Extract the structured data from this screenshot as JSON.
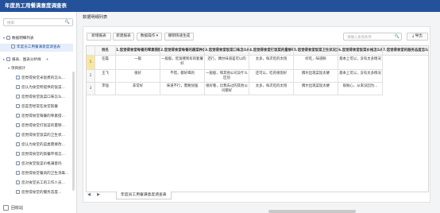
{
  "window": {
    "title": "年度员工用餐满意度调查表"
  },
  "sidebar": {
    "search_placeholder": "搜索",
    "items": [
      {
        "label": "数据明细列表",
        "level": 0,
        "arrow": "▾",
        "icon": "folder-icon"
      },
      {
        "label": "年度员工用餐满意度调查表",
        "level": 1,
        "arrow": "",
        "icon": "table-icon",
        "selected": true
      },
      {
        "label": "报表、图表分析样",
        "level": 0,
        "arrow": "▸",
        "icon": "folder-icon",
        "extra": "+"
      },
      {
        "label": "项目统计",
        "level": 1,
        "arrow": "▾",
        "icon": ""
      },
      {
        "label": "您觉得食堂米饭煮的怎么...",
        "level": 2,
        "icon": "chart-icon"
      },
      {
        "label": "您认为食堂所提供的饭菜...",
        "level": 2,
        "icon": "chart-icon"
      },
      {
        "label": "您觉得食堂饭菜口味怎么...",
        "level": 2,
        "icon": "chart-icon"
      },
      {
        "label": "您是否经常在食堂就餐",
        "level": 2,
        "icon": "chart-icon"
      },
      {
        "label": "您觉得食堂每餐的荤素搭...",
        "level": 2,
        "icon": "chart-icon"
      },
      {
        "label": "您觉得食堂打饭菜的量够...",
        "level": 2,
        "icon": "chart-icon"
      },
      {
        "label": "您觉得食堂饭菜的卫生状...",
        "level": 2,
        "icon": "chart-icon"
      },
      {
        "label": "您认为食堂的菜类需要改...",
        "level": 2,
        "icon": "chart-icon"
      },
      {
        "label": "您觉得食堂的就餐环境怎...",
        "level": 2,
        "icon": "chart-icon"
      },
      {
        "label": "您对食堂饭菜价格满意吗",
        "level": 2,
        "icon": "chart-icon"
      },
      {
        "label": "您觉得食堂餐具的卫生消毒...",
        "level": 2,
        "icon": "chart-icon"
      },
      {
        "label": "您对食堂员工的工作人员...",
        "level": 2,
        "icon": "chart-icon"
      },
      {
        "label": "您觉得食堂的服务态度...",
        "level": 2,
        "icon": "chart-icon"
      }
    ],
    "recycle_label": "回收站"
  },
  "main": {
    "header": "数据明细列表",
    "toolbar": {
      "buttons": [
        "新增报表",
        "新建报表",
        "数据操作 ▾",
        "撤销快速生成"
      ],
      "search_placeholder": "请输入查询条件",
      "export_label": "导出"
    },
    "table": {
      "columns": [
        "",
        "姓名",
        "1.您觉得食堂每餐的荤素搭配怎么样",
        "2.您觉得食堂每餐的蔬菜种类够丰富吗",
        "3.您觉得食堂饭菜口味怎么样",
        "4.您觉得食堂打饭菜的量够吗",
        "5.您觉得食堂饭菜卫生状况怎么样",
        "6.您觉得食堂饭菜价格怎么样",
        "7.您觉得食堂的服务态度怎么样"
      ],
      "rows": [
        {
          "num": "1",
          "cells": [
            "任磊",
            "一般",
            "一般般，吃饭哪到有的套餐好",
            "还行，偶尔味道差可以的",
            "太多，每次吃的太饱",
            "好吃，味道鲜",
            "基本上可以，没有太多情况"
          ]
        },
        {
          "num": "2",
          "cells": [
            "王飞",
            "很好",
            "不错，都好喝的",
            "一般般，和其他公司没什么区别",
            "还可以，吃的很饱好",
            "偶尔出现菜饭太硬",
            "基本上可以，没有太多情况"
          ]
        },
        {
          "num": "3",
          "cells": [
            "李强",
            "非常好",
            "味道不行，需要加强",
            "很好看，比我去过的其他公司都好",
            "太多，每次吃的太饱",
            "偶尔出现菜饭太硬",
            "很耐心，从来没因为..."
          ]
        }
      ]
    },
    "sheet_tab": "年度员工用餐满意度调查表"
  },
  "colors": {
    "titlebar": "#24529a",
    "selected_row": "#f9e79f"
  }
}
